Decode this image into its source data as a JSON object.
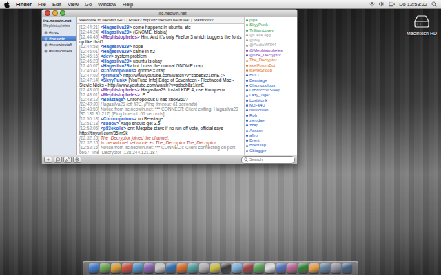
{
  "menu_bar": {
    "app": "Finder",
    "menus": [
      "File",
      "Edit",
      "View",
      "Go",
      "Window",
      "Help"
    ],
    "clock": "Do 12:53:22"
  },
  "desktop_icons": [
    {
      "label": "Macintosh HD"
    }
  ],
  "window": {
    "title": "irc.neowin.net"
  },
  "sidebar": {
    "server": "irc.neowin.net",
    "nickname": "Mephistopheles",
    "items": [
      {
        "label": "#mvc",
        "selected": false
      },
      {
        "label": "#neowin",
        "selected": true
      },
      {
        "label": "#neowinstaff",
        "selected": false
      },
      {
        "label": "#subscribers",
        "selected": false
      }
    ]
  },
  "topic": "Welcome to Neowin IRC! | Rules? http://irc.neowin.net/rules/ | Staffroom?",
  "messages": [
    {
      "time": "[12:44:21]",
      "nick": "<Hagasilva29>",
      "text": "some happens in ubuntu, etc",
      "kind": "message",
      "color": "#2a5fc4"
    },
    {
      "time": "[12:44:24]",
      "nick": "<Hagasilva29>",
      "text": "(GNOME, blabla)",
      "kind": "message",
      "color": "#2a5fc4"
    },
    {
      "time": "[12:44:49]",
      "nick": "<Mephistopheles>",
      "text": "Hm. And it's only Firefox 3 which buggers the fonts up like that?",
      "kind": "message",
      "color": "#7a3fb0"
    },
    {
      "time": "[12:44:58]",
      "nick": "<Hagasilva29>",
      "text": "nope",
      "kind": "message",
      "color": "#2a5fc4"
    },
    {
      "time": "[12:45:01]",
      "nick": "<Hagasilva29>",
      "text": "same in ff2",
      "kind": "message",
      "color": "#2a5fc4"
    },
    {
      "time": "[12:45:16]",
      "nick": "<dev>",
      "text": "system problem",
      "kind": "message",
      "color": "#2a5fc4"
    },
    {
      "time": "[12:45:23]",
      "nick": "<Hagasilva29>",
      "text": "ubuntu is okay",
      "kind": "message",
      "color": "#2a5fc4"
    },
    {
      "time": "[12:46:07]",
      "nick": "<Hagasilva29>",
      "text": "but I miss the normal GNOME crap",
      "kind": "message",
      "color": "#2a5fc4"
    },
    {
      "time": "[12:46:41]",
      "nick": "<Chronopolous>",
      "text": "gnome = crap",
      "kind": "message",
      "color": "#2a5fc4"
    },
    {
      "time": "[12:47:02]",
      "nick": "<primate>",
      "text": "http://www.youtube.com/watch?v=sdbeb8z1ktnE  :>",
      "kind": "message",
      "color": "#2a5fc4"
    },
    {
      "time": "[12:47:14]",
      "nick": "<SkyyPunk>",
      "text": "[YouTube Info] Edge of Seventeen - Fleetwood Mac - Stevie Nicks - http://www.youtube.com/watch?v=sdbeb8z1ktnE",
      "kind": "message",
      "color": "#2a5fc4"
    },
    {
      "time": "[12:48:00]",
      "nick": "<Mephistopheles>",
      "text": "Hagasilva29: install KDE 4, use Konqueror.",
      "kind": "message",
      "color": "#7a3fb0"
    },
    {
      "time": "[12:48:01]",
      "nick": "<Mephistopheles>",
      "text": ":P",
      "kind": "message",
      "color": "#7a3fb0"
    },
    {
      "time": "[12:48:12]",
      "nick": "<Beastage>",
      "text": "Chronopolous u has xbox360?",
      "kind": "message",
      "color": "#2a5fc4"
    },
    {
      "time": "[12:48:30]",
      "nick": "",
      "text": "Hagasilva29 left IRC. (Ping timeout: 61 seconds)",
      "kind": "event",
      "color": "#808080"
    },
    {
      "time": "[12:48:50]",
      "nick": "",
      "text": "Notice from irc.neowin.net: *** CONNECT: Client exiting: Hagasilva29 [85.181.31.217] [Ping timeout: 61 seconds]",
      "kind": "notice",
      "color": "#808080"
    },
    {
      "time": "[12:50:18]",
      "nick": "<Chronopolous>",
      "text": "no Beastage",
      "kind": "message",
      "color": "#2a5fc4"
    },
    {
      "time": "[12:51:13]",
      "nick": "<sudov>",
      "text": "Xago should get 3.5",
      "kind": "message",
      "color": "#2a5fc4"
    },
    {
      "time": "[12:52:05]",
      "nick": "<p83ekolls>",
      "text": "cnr: Megabe stays if no run-off vote, official says http://tinyurl.com/35lm9k",
      "kind": "message",
      "color": "#2a5fc4"
    },
    {
      "time": "[12:52:15]",
      "nick": "",
      "text": "The_Decryptor joined the channel.",
      "kind": "event",
      "color": "#c0392b"
    },
    {
      "time": "[12:52:15]",
      "nick": "",
      "text": "irc.neowin.net set mode +o The_Decryptor The_Decryptor.",
      "kind": "event",
      "color": "#c0392b"
    },
    {
      "time": "[12:52:15]",
      "nick": "",
      "text": "Notice from irc.neowin.net: *** CONNECT: Client connecting on port 6667: The_Decryptor [128.244.121.187]",
      "kind": "notice",
      "color": "#808080"
    }
  ],
  "nicks": [
    {
      "name": "pipa",
      "color": "#2e9e4f"
    },
    {
      "name": "SkyyPunk",
      "color": "#2e9e4f"
    },
    {
      "name": "TrilliumLuvey",
      "color": "#2e9e4f"
    },
    {
      "name": "@DeskJigg",
      "color": "#9a9a9a"
    },
    {
      "name": "@irvy",
      "color": "#9a9a9a"
    },
    {
      "name": "@AudioWRX4",
      "color": "#9a9a9a"
    },
    {
      "name": "@Mephistopheles",
      "color": "#7a3fb0"
    },
    {
      "name": "@The_Decryptor",
      "color": "#7a3fb0"
    },
    {
      "name": "The_Decryptor",
      "color": "#e07020"
    },
    {
      "name": "ske|ForumBot",
      "color": "#e07020"
    },
    {
      "name": "stevieSnoop",
      "color": "#e07020"
    },
    {
      "name": "BOO",
      "color": "#2a5fc4"
    },
    {
      "name": "Beastage",
      "color": "#2a5fc4"
    },
    {
      "name": "Chronopolous",
      "color": "#2a5fc4"
    },
    {
      "name": "DrBroccoli Sleep",
      "color": "#2a5fc4"
    },
    {
      "name": "Lazy_Tiger",
      "color": "#2a5fc4"
    },
    {
      "name": "LostMonk",
      "color": "#2a5fc4"
    },
    {
      "name": "M2Fs4U",
      "color": "#2a5fc4"
    },
    {
      "name": "musicman",
      "color": "#2a5fc4"
    },
    {
      "name": "Roh",
      "color": "#2a5fc4"
    },
    {
      "name": "zerodae",
      "color": "#2a5fc4"
    },
    {
      "name": "zzap",
      "color": "#2a5fc4"
    },
    {
      "name": "Aasam",
      "color": "#2a5fc4"
    },
    {
      "name": "affro",
      "color": "#2a5fc4"
    },
    {
      "name": "Brent",
      "color": "#2a5fc4"
    },
    {
      "name": "BrentJap",
      "color": "#2a5fc4"
    },
    {
      "name": "Cbiagger",
      "color": "#2a5fc4"
    }
  ],
  "search": {
    "placeholder": "Search"
  }
}
